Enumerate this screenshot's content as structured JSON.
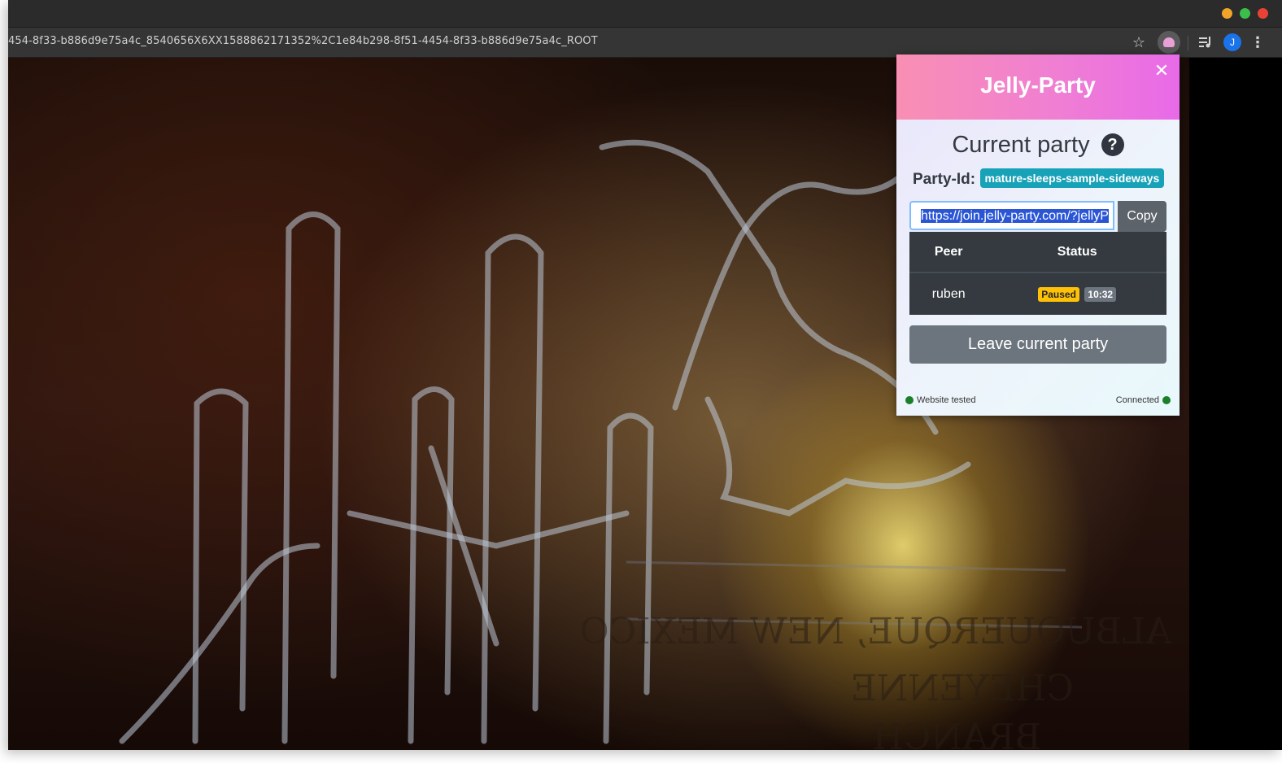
{
  "browser": {
    "url": "454-8f33-b886d9e75a4c_8540656X6XX1588862171352%2C1e84b298-8f51-4454-8f33-b886d9e75a4c_ROOT",
    "avatar_letter": "J",
    "icons": [
      "star-icon",
      "jelly-extension-icon",
      "media-queue-icon",
      "profile-avatar",
      "kebab-menu-icon"
    ]
  },
  "popup": {
    "title": "Jelly-Party",
    "section_title": "Current party",
    "help_symbol": "?",
    "party_id_label": "Party-Id:",
    "party_id": "mature-sleeps-sample-sideways",
    "join_link": "https://join.jelly-party.com/?jellyP",
    "copy_label": "Copy",
    "table": {
      "headers": [
        "Peer",
        "Status"
      ],
      "rows": [
        {
          "peer": "ruben",
          "status": "Paused",
          "time": "10:32"
        }
      ]
    },
    "leave_label": "Leave current party",
    "footer_left": "Website tested",
    "footer_right": "Connected"
  },
  "colors": {
    "header_gradient_start": "#f98fb3",
    "header_gradient_end": "#e86ae8",
    "party_badge": "#17a2b8",
    "paused_badge": "#ffc107",
    "status_dot": "#1b7f2a"
  }
}
